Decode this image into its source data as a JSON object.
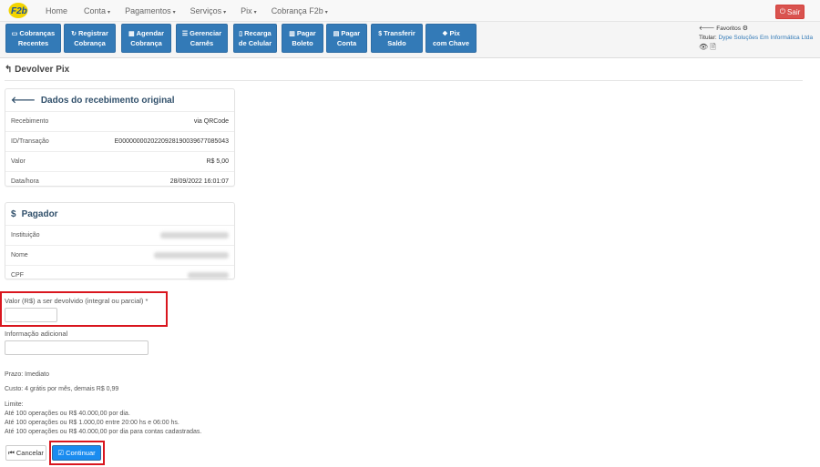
{
  "nav": {
    "logo_text": "F2b",
    "items": [
      {
        "label": "Home",
        "caret": ""
      },
      {
        "label": "Conta",
        "caret": "▾"
      },
      {
        "label": "Pagamentos",
        "caret": "▾"
      },
      {
        "label": "Serviços",
        "caret": "▾"
      },
      {
        "label": "Pix",
        "caret": "▾"
      },
      {
        "label": "Cobrança F2b",
        "caret": "▾"
      }
    ],
    "sair_label": "Sair"
  },
  "toolbar": {
    "buttons": [
      {
        "line1": "Cobranças",
        "line2": "Recentes",
        "icon": "card-icon"
      },
      {
        "line1": "Registrar",
        "line2": "Cobrança",
        "icon": "register-icon"
      },
      {
        "line1": "Agendar",
        "line2": "Cobrança",
        "icon": "calendar-icon"
      },
      {
        "line1": "Gerenciar",
        "line2": "Carnês",
        "icon": "list-icon"
      },
      {
        "line1": "Recarga",
        "line2": "de Celular",
        "icon": "phone-icon"
      },
      {
        "line1": "Pagar",
        "line2": "Boleto",
        "icon": "barcode-icon"
      },
      {
        "line1": "Pagar",
        "line2": "Conta",
        "icon": "bill-icon"
      },
      {
        "line1": "Transferir",
        "line2": "Saldo",
        "icon": "dollar-icon"
      },
      {
        "line1": "Pix",
        "line2": "com Chave",
        "icon": "pix-icon"
      }
    ],
    "favoritos_label": "Favoritos",
    "titular_label": "Titular:",
    "titular_name": "Dype Soluções Em Informática Ltda"
  },
  "page": {
    "title": "Devolver Pix"
  },
  "original": {
    "heading": "Dados do recebimento original",
    "rows": [
      {
        "label": "Recebimento",
        "value": "via QRCode"
      },
      {
        "label": "ID/Transação",
        "value": "E00000000202209281900396770850​43"
      },
      {
        "label": "Valor",
        "value": "R$ 5,00"
      },
      {
        "label": "Data/hora",
        "value": "28/09/2022 16:01:07"
      }
    ]
  },
  "pagador": {
    "heading": "Pagador",
    "rows": [
      {
        "label": "Instituição"
      },
      {
        "label": "Nome"
      },
      {
        "label": "CPF"
      }
    ]
  },
  "form": {
    "valor_label": "Valor (R$) a ser devolvido (integral ou parcial) *",
    "valor_value": "",
    "info_label": "Informação adicional",
    "info_value": ""
  },
  "notes": {
    "prazo": "Prazo: Imediato",
    "custo": "Custo: 4 grátis por mês, demais R$ 0,99",
    "limite_title": "Limite:",
    "limite_lines": [
      "Até 100 operações ou R$ 40.000,00 por dia.",
      "Até 100 operações ou R$ 1.000,00 entre 20:00 hs e 06:00 hs.",
      "Até 100 operações ou R$ 40.000,00 por dia para contas cadastradas."
    ]
  },
  "actions": {
    "cancel_label": "Cancelar",
    "continue_label": "Continuar"
  },
  "colors": {
    "primary": "#337ab7",
    "danger": "#d9534f",
    "highlight": "#d9161e",
    "continue": "#1a8cf0"
  }
}
